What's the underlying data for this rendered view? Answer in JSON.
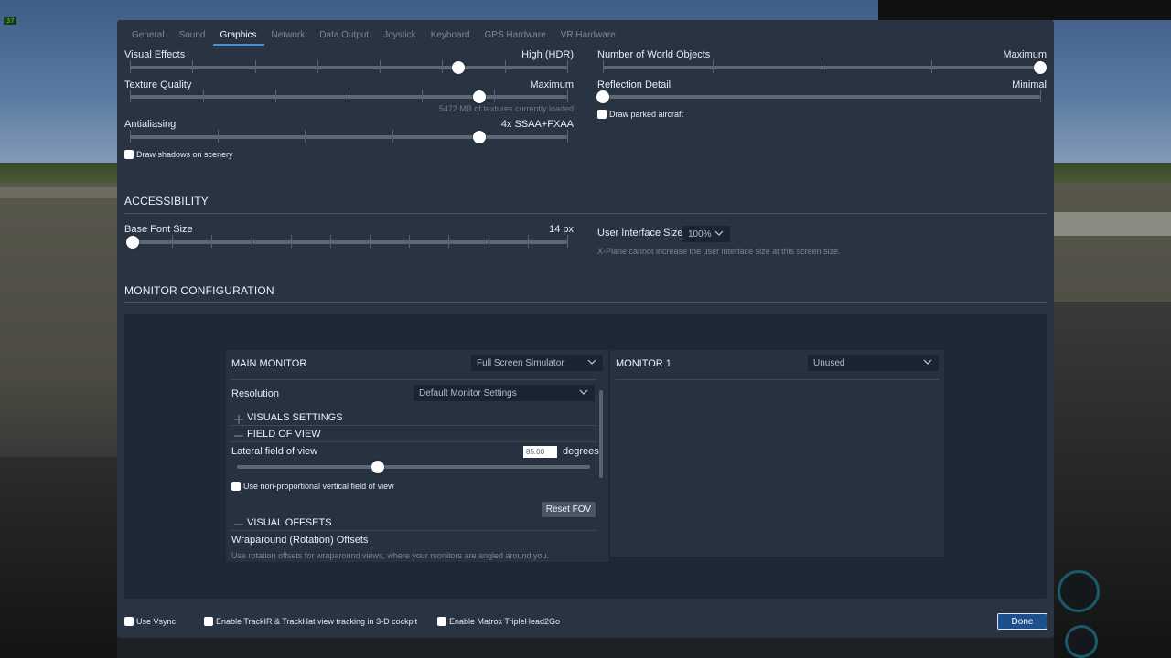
{
  "tabs": [
    {
      "label": "General"
    },
    {
      "label": "Sound"
    },
    {
      "label": "Graphics",
      "active": true
    },
    {
      "label": "Network"
    },
    {
      "label": "Data Output"
    },
    {
      "label": "Joystick"
    },
    {
      "label": "Keyboard"
    },
    {
      "label": "GPS Hardware"
    },
    {
      "label": "VR Hardware"
    }
  ],
  "graphics": {
    "visual_effects": {
      "label": "Visual Effects",
      "value": "High (HDR)",
      "level": 0.75
    },
    "texture_quality": {
      "label": "Texture Quality",
      "value": "Maximum",
      "note": "5472 MB of textures currently loaded",
      "level": 0.8
    },
    "antialiasing": {
      "label": "Antialiasing",
      "value": "4x SSAA+FXAA",
      "level": 0.8
    },
    "draw_shadows": {
      "label": "Draw shadows on scenery",
      "checked": false
    },
    "world_objects": {
      "label": "Number of World Objects",
      "value": "Maximum",
      "level": 1.0
    },
    "reflection_detail": {
      "label": "Reflection Detail",
      "value": "Minimal",
      "level": 0.0
    },
    "draw_parked": {
      "label": "Draw parked aircraft",
      "checked": false
    }
  },
  "accessibility": {
    "title": "ACCESSIBILITY",
    "base_font": {
      "label": "Base Font Size",
      "value": "14 px",
      "level": 0.0
    },
    "ui_size": {
      "label": "User Interface Size",
      "value": "100%",
      "note": "X-Plane cannot increase the user interface size at this screen size."
    }
  },
  "monitor_config": {
    "title": "MONITOR CONFIGURATION",
    "main": {
      "title": "MAIN MONITOR",
      "mode": "Full Screen Simulator",
      "resolution_label": "Resolution",
      "resolution_value": "Default Monitor Settings",
      "visuals_settings": "VISUALS SETTINGS",
      "field_of_view": "FIELD OF VIEW",
      "lateral_fov_label": "Lateral field of view",
      "lateral_fov_value": "85.00",
      "lateral_fov_unit": "degrees",
      "lateral_fov_level": 0.4,
      "non_prop_label": "Use non-proportional vertical field of view",
      "reset_fov": "Reset FOV",
      "visual_offsets": "VISUAL OFFSETS",
      "wraparound_title": "Wraparound (Rotation) Offsets",
      "wraparound_note": "Use rotation offsets for wraparound views, where your monitors are angled around you."
    },
    "monitor1": {
      "title": "MONITOR 1",
      "mode": "Unused"
    }
  },
  "footer": {
    "vsync": "Use Vsync",
    "trackir": "Enable TrackIR & TrackHat view tracking in 3-D cockpit",
    "matrox": "Enable Matrox TripleHead2Go",
    "done": "Done"
  },
  "hud": {
    "fps": "37"
  },
  "colors": {
    "accent": "#4a8fd8",
    "dialog_bg": "#293442",
    "done_button": "#1d4f8d"
  }
}
